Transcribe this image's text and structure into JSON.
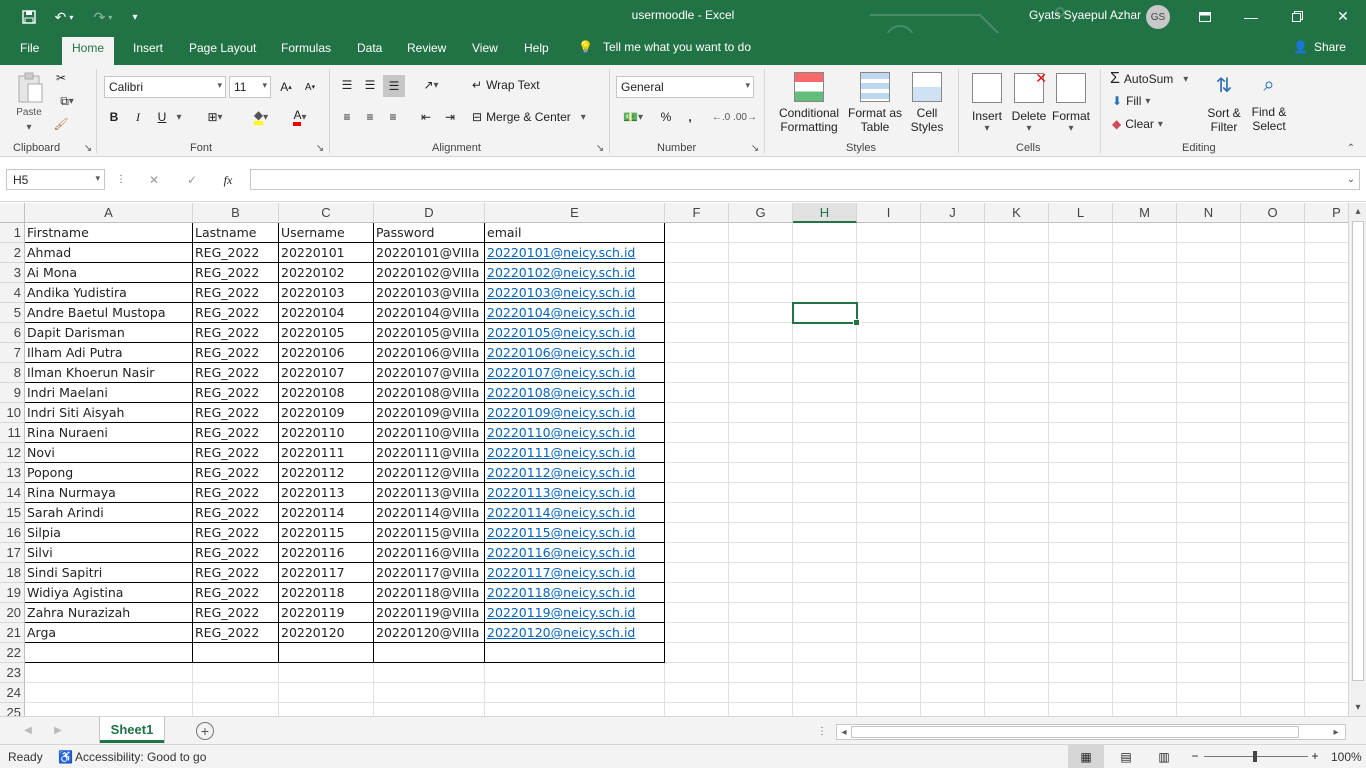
{
  "window": {
    "title": "usermoodle  -  Excel",
    "user_name": "Gyats Syaepul Azhar",
    "user_initials": "GS"
  },
  "ribbon_tabs": [
    "File",
    "Home",
    "Insert",
    "Page Layout",
    "Formulas",
    "Data",
    "Review",
    "View",
    "Help"
  ],
  "tell_me": "Tell me what you want to do",
  "share": "Share",
  "ribbon": {
    "clipboard": {
      "label": "Clipboard",
      "paste": "Paste"
    },
    "font": {
      "label": "Font",
      "font_name": "Calibri",
      "font_size": "11",
      "bold": "B",
      "italic": "I",
      "underline": "U"
    },
    "alignment": {
      "label": "Alignment",
      "wrap_text": "Wrap Text",
      "merge_center": "Merge & Center"
    },
    "number": {
      "label": "Number",
      "format": "General",
      "percent": "%",
      "comma": ","
    },
    "styles": {
      "label": "Styles",
      "conditional_1": "Conditional",
      "conditional_2": "Formatting",
      "format_table_1": "Format as",
      "format_table_2": "Table",
      "cell_styles_1": "Cell",
      "cell_styles_2": "Styles"
    },
    "cells": {
      "label": "Cells",
      "insert": "Insert",
      "delete": "Delete",
      "format": "Format"
    },
    "editing": {
      "label": "Editing",
      "autosum": "AutoSum",
      "fill": "Fill",
      "clear": "Clear",
      "sort_1": "Sort &",
      "sort_2": "Filter",
      "find_1": "Find &",
      "find_2": "Select"
    }
  },
  "formula_bar": {
    "name_box": "H5",
    "fx": "fx",
    "value": ""
  },
  "columns": [
    "A",
    "B",
    "C",
    "D",
    "E",
    "F",
    "G",
    "H",
    "I",
    "J",
    "K",
    "L",
    "M",
    "N",
    "O",
    "P"
  ],
  "selected_column": "H",
  "header_row": [
    "Firstname",
    "Lastname",
    "Username",
    "Password",
    "email"
  ],
  "rows": [
    [
      "Ahmad",
      "REG_2022",
      "20220101",
      "20220101@VIIIa",
      "20220101@neicy.sch.id"
    ],
    [
      "Ai Mona",
      "REG_2022",
      "20220102",
      "20220102@VIIIa",
      "20220102@neicy.sch.id"
    ],
    [
      "Andika Yudistira",
      "REG_2022",
      "20220103",
      "20220103@VIIIa",
      "20220103@neicy.sch.id"
    ],
    [
      "Andre Baetul Mustopa",
      "REG_2022",
      "20220104",
      "20220104@VIIIa",
      "20220104@neicy.sch.id"
    ],
    [
      "Dapit Darisman",
      "REG_2022",
      "20220105",
      "20220105@VIIIa",
      "20220105@neicy.sch.id"
    ],
    [
      "Ilham Adi Putra",
      "REG_2022",
      "20220106",
      "20220106@VIIIa",
      "20220106@neicy.sch.id"
    ],
    [
      "Ilman Khoerun Nasir",
      "REG_2022",
      "20220107",
      "20220107@VIIIa",
      "20220107@neicy.sch.id"
    ],
    [
      "Indri Maelani",
      "REG_2022",
      "20220108",
      "20220108@VIIIa",
      "20220108@neicy.sch.id"
    ],
    [
      "Indri Siti Aisyah",
      "REG_2022",
      "20220109",
      "20220109@VIIIa",
      "20220109@neicy.sch.id"
    ],
    [
      "Rina Nuraeni",
      "REG_2022",
      "20220110",
      "20220110@VIIIa",
      "20220110@neicy.sch.id"
    ],
    [
      "Novi",
      "REG_2022",
      "20220111",
      "20220111@VIIIa",
      "20220111@neicy.sch.id"
    ],
    [
      "Popong",
      "REG_2022",
      "20220112",
      "20220112@VIIIa",
      "20220112@neicy.sch.id"
    ],
    [
      "Rina Nurmaya",
      "REG_2022",
      "20220113",
      "20220113@VIIIa",
      "20220113@neicy.sch.id"
    ],
    [
      "Sarah Arindi",
      "REG_2022",
      "20220114",
      "20220114@VIIIa",
      "20220114@neicy.sch.id"
    ],
    [
      "Silpia",
      "REG_2022",
      "20220115",
      "20220115@VIIIa",
      "20220115@neicy.sch.id"
    ],
    [
      "Silvi",
      "REG_2022",
      "20220116",
      "20220116@VIIIa",
      "20220116@neicy.sch.id"
    ],
    [
      "Sindi Sapitri",
      "REG_2022",
      "20220117",
      "20220117@VIIIa",
      "20220117@neicy.sch.id"
    ],
    [
      "Widiya Agistina",
      "REG_2022",
      "20220118",
      "20220118@VIIIa",
      "20220118@neicy.sch.id"
    ],
    [
      "Zahra Nurazizah",
      "REG_2022",
      "20220119",
      "20220119@VIIIa",
      "20220119@neicy.sch.id"
    ],
    [
      "Arga",
      "REG_2022",
      "20220120",
      "20220120@VIIIa",
      "20220120@neicy.sch.id"
    ]
  ],
  "visible_row_numbers": [
    "1",
    "2",
    "3",
    "4",
    "5",
    "6",
    "7",
    "8",
    "9",
    "10",
    "11",
    "12",
    "13",
    "14",
    "15",
    "16",
    "17",
    "18",
    "19",
    "20",
    "21",
    "22",
    "23",
    "24",
    "25"
  ],
  "sheet_tab": "Sheet1",
  "status": {
    "ready": "Ready",
    "accessibility": "Accessibility: Good to go",
    "zoom": "100%"
  },
  "colors": {
    "excel_green": "#217346",
    "link_blue": "#0563c1"
  }
}
